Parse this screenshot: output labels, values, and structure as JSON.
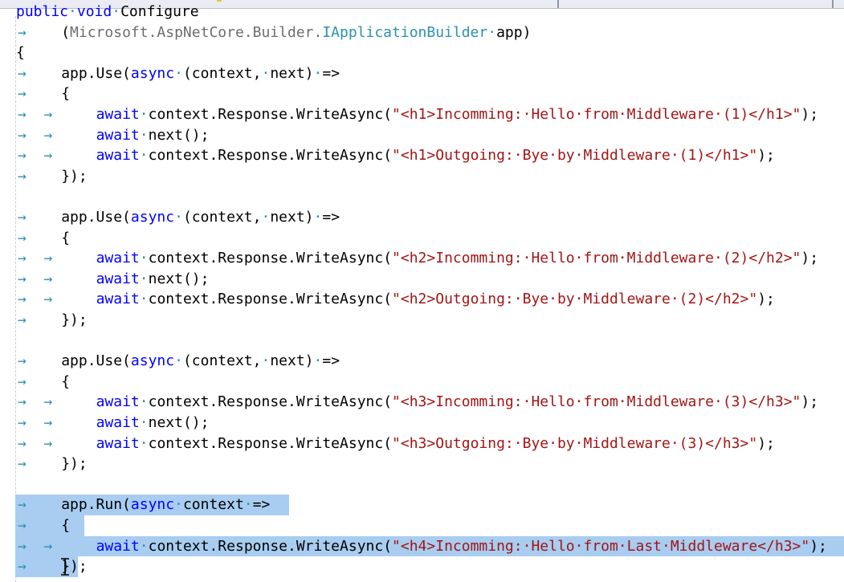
{
  "editor": {
    "language": "csharp",
    "colors": {
      "keyword": "#0000ff",
      "type": "#2b91af",
      "string": "#a31515",
      "text": "#000000",
      "selection": "#a8cdf0"
    },
    "lines": [
      {
        "tokens": [
          {
            "t": "kw",
            "v": "public"
          },
          {
            "t": "dot",
            "v": "·"
          },
          {
            "t": "kw",
            "v": "void"
          },
          {
            "t": "dot",
            "v": "·"
          },
          {
            "t": "plain",
            "v": "Configure"
          }
        ]
      },
      {
        "tokens": [
          {
            "t": "arrow",
            "v": "→ "
          },
          {
            "t": "plain",
            "v": "   ("
          },
          {
            "t": "ns",
            "v": "Microsoft.AspNetCore.Builder."
          },
          {
            "t": "type",
            "v": "IApplicationBuilder"
          },
          {
            "t": "dot",
            "v": "·"
          },
          {
            "t": "plain",
            "v": "app)"
          }
        ]
      },
      {
        "tokens": [
          {
            "t": "plain",
            "v": "{"
          }
        ]
      },
      {
        "tokens": [
          {
            "t": "arrow",
            "v": "→ "
          },
          {
            "t": "plain",
            "v": "   app.Use("
          },
          {
            "t": "kw",
            "v": "async"
          },
          {
            "t": "dot",
            "v": "·"
          },
          {
            "t": "plain",
            "v": "(context,"
          },
          {
            "t": "dot",
            "v": "·"
          },
          {
            "t": "plain",
            "v": "next)"
          },
          {
            "t": "dot",
            "v": "·"
          },
          {
            "t": "plain",
            "v": "=>"
          }
        ]
      },
      {
        "tokens": [
          {
            "t": "arrow",
            "v": "→ "
          },
          {
            "t": "plain",
            "v": "   {"
          }
        ]
      },
      {
        "tokens": [
          {
            "t": "arrow",
            "v": "→ "
          },
          {
            "t": "plain",
            "v": " "
          },
          {
            "t": "arrow",
            "v": "→ "
          },
          {
            "t": "plain",
            "v": "    "
          },
          {
            "t": "kw",
            "v": "await"
          },
          {
            "t": "dot",
            "v": "·"
          },
          {
            "t": "plain",
            "v": "context.Response.WriteAsync("
          },
          {
            "t": "str",
            "v": "\"<h1>Incomming:·Hello·from·Middleware·(1)</h1>\""
          },
          {
            "t": "plain",
            "v": ");"
          }
        ]
      },
      {
        "tokens": [
          {
            "t": "arrow",
            "v": "→ "
          },
          {
            "t": "plain",
            "v": " "
          },
          {
            "t": "arrow",
            "v": "→ "
          },
          {
            "t": "plain",
            "v": "    "
          },
          {
            "t": "kw",
            "v": "await"
          },
          {
            "t": "dot",
            "v": "·"
          },
          {
            "t": "plain",
            "v": "next();"
          }
        ]
      },
      {
        "tokens": [
          {
            "t": "arrow",
            "v": "→ "
          },
          {
            "t": "plain",
            "v": " "
          },
          {
            "t": "arrow",
            "v": "→ "
          },
          {
            "t": "plain",
            "v": "    "
          },
          {
            "t": "kw",
            "v": "await"
          },
          {
            "t": "dot",
            "v": "·"
          },
          {
            "t": "plain",
            "v": "context.Response.WriteAsync("
          },
          {
            "t": "str",
            "v": "\"<h1>Outgoing:·Bye·by·Middleware·(1)</h1>\""
          },
          {
            "t": "plain",
            "v": ");"
          }
        ]
      },
      {
        "tokens": [
          {
            "t": "arrow",
            "v": "→ "
          },
          {
            "t": "plain",
            "v": "   });"
          }
        ]
      },
      {
        "tokens": []
      },
      {
        "tokens": [
          {
            "t": "arrow",
            "v": "→ "
          },
          {
            "t": "plain",
            "v": "   app.Use("
          },
          {
            "t": "kw",
            "v": "async"
          },
          {
            "t": "dot",
            "v": "·"
          },
          {
            "t": "plain",
            "v": "(context,"
          },
          {
            "t": "dot",
            "v": "·"
          },
          {
            "t": "plain",
            "v": "next)"
          },
          {
            "t": "dot",
            "v": "·"
          },
          {
            "t": "plain",
            "v": "=>"
          }
        ]
      },
      {
        "tokens": [
          {
            "t": "arrow",
            "v": "→ "
          },
          {
            "t": "plain",
            "v": "   {"
          }
        ]
      },
      {
        "tokens": [
          {
            "t": "arrow",
            "v": "→ "
          },
          {
            "t": "plain",
            "v": " "
          },
          {
            "t": "arrow",
            "v": "→ "
          },
          {
            "t": "plain",
            "v": "    "
          },
          {
            "t": "kw",
            "v": "await"
          },
          {
            "t": "dot",
            "v": "·"
          },
          {
            "t": "plain",
            "v": "context.Response.WriteAsync("
          },
          {
            "t": "str",
            "v": "\"<h2>Incomming:·Hello·from·Middleware·(2)</h2>\""
          },
          {
            "t": "plain",
            "v": ");"
          }
        ]
      },
      {
        "tokens": [
          {
            "t": "arrow",
            "v": "→ "
          },
          {
            "t": "plain",
            "v": " "
          },
          {
            "t": "arrow",
            "v": "→ "
          },
          {
            "t": "plain",
            "v": "    "
          },
          {
            "t": "kw",
            "v": "await"
          },
          {
            "t": "dot",
            "v": "·"
          },
          {
            "t": "plain",
            "v": "next();"
          }
        ]
      },
      {
        "tokens": [
          {
            "t": "arrow",
            "v": "→ "
          },
          {
            "t": "plain",
            "v": " "
          },
          {
            "t": "arrow",
            "v": "→ "
          },
          {
            "t": "plain",
            "v": "    "
          },
          {
            "t": "kw",
            "v": "await"
          },
          {
            "t": "dot",
            "v": "·"
          },
          {
            "t": "plain",
            "v": "context.Response.WriteAsync("
          },
          {
            "t": "str",
            "v": "\"<h2>Outgoing:·Bye·by·Middleware·(2)</h2>\""
          },
          {
            "t": "plain",
            "v": ");"
          }
        ]
      },
      {
        "tokens": [
          {
            "t": "arrow",
            "v": "→ "
          },
          {
            "t": "plain",
            "v": "   });"
          }
        ]
      },
      {
        "tokens": []
      },
      {
        "tokens": [
          {
            "t": "arrow",
            "v": "→ "
          },
          {
            "t": "plain",
            "v": "   app.Use("
          },
          {
            "t": "kw",
            "v": "async"
          },
          {
            "t": "dot",
            "v": "·"
          },
          {
            "t": "plain",
            "v": "(context,"
          },
          {
            "t": "dot",
            "v": "·"
          },
          {
            "t": "plain",
            "v": "next)"
          },
          {
            "t": "dot",
            "v": "·"
          },
          {
            "t": "plain",
            "v": "=>"
          }
        ]
      },
      {
        "tokens": [
          {
            "t": "arrow",
            "v": "→ "
          },
          {
            "t": "plain",
            "v": "   {"
          }
        ]
      },
      {
        "tokens": [
          {
            "t": "arrow",
            "v": "→ "
          },
          {
            "t": "plain",
            "v": " "
          },
          {
            "t": "arrow",
            "v": "→ "
          },
          {
            "t": "plain",
            "v": "    "
          },
          {
            "t": "kw",
            "v": "await"
          },
          {
            "t": "dot",
            "v": "·"
          },
          {
            "t": "plain",
            "v": "context.Response.WriteAsync("
          },
          {
            "t": "str",
            "v": "\"<h3>Incomming:·Hello·from·Middleware·(3)</h3>\""
          },
          {
            "t": "plain",
            "v": ");"
          }
        ]
      },
      {
        "tokens": [
          {
            "t": "arrow",
            "v": "→ "
          },
          {
            "t": "plain",
            "v": " "
          },
          {
            "t": "arrow",
            "v": "→ "
          },
          {
            "t": "plain",
            "v": "    "
          },
          {
            "t": "kw",
            "v": "await"
          },
          {
            "t": "dot",
            "v": "·"
          },
          {
            "t": "plain",
            "v": "next();"
          }
        ]
      },
      {
        "tokens": [
          {
            "t": "arrow",
            "v": "→ "
          },
          {
            "t": "plain",
            "v": " "
          },
          {
            "t": "arrow",
            "v": "→ "
          },
          {
            "t": "plain",
            "v": "    "
          },
          {
            "t": "kw",
            "v": "await"
          },
          {
            "t": "dot",
            "v": "·"
          },
          {
            "t": "plain",
            "v": "context.Response.WriteAsync("
          },
          {
            "t": "str",
            "v": "\"<h3>Outgoing:·Bye·by·Middleware·(3)</h3>\""
          },
          {
            "t": "plain",
            "v": ");"
          }
        ]
      },
      {
        "tokens": [
          {
            "t": "arrow",
            "v": "→ "
          },
          {
            "t": "plain",
            "v": "   });"
          }
        ]
      },
      {
        "tokens": []
      },
      {
        "selected": true,
        "tokens": [
          {
            "t": "arrow",
            "v": "→ "
          },
          {
            "t": "plain",
            "v": "   app.Run("
          },
          {
            "t": "kw",
            "v": "async"
          },
          {
            "t": "dot",
            "v": "·"
          },
          {
            "t": "plain",
            "v": "context"
          },
          {
            "t": "dot",
            "v": "·"
          },
          {
            "t": "plain",
            "v": "=>"
          }
        ]
      },
      {
        "selected": true,
        "tokens": [
          {
            "t": "arrow",
            "v": "→ "
          },
          {
            "t": "plain",
            "v": "   {"
          }
        ]
      },
      {
        "selected": true,
        "tokens": [
          {
            "t": "arrow",
            "v": "→ "
          },
          {
            "t": "plain",
            "v": " "
          },
          {
            "t": "arrow",
            "v": "→ "
          },
          {
            "t": "plain",
            "v": "    "
          },
          {
            "t": "kw",
            "v": "await"
          },
          {
            "t": "dot",
            "v": "·"
          },
          {
            "t": "plain",
            "v": "context.Response.WriteAsync("
          },
          {
            "t": "str",
            "v": "\"<h4>Incomming:·Hello·from·Last·Middleware</h3>\""
          },
          {
            "t": "plain",
            "v": ");"
          }
        ]
      },
      {
        "selected": true,
        "tokens": [
          {
            "t": "arrow",
            "v": "→ "
          },
          {
            "t": "plain",
            "v": "   });"
          }
        ]
      }
    ]
  }
}
